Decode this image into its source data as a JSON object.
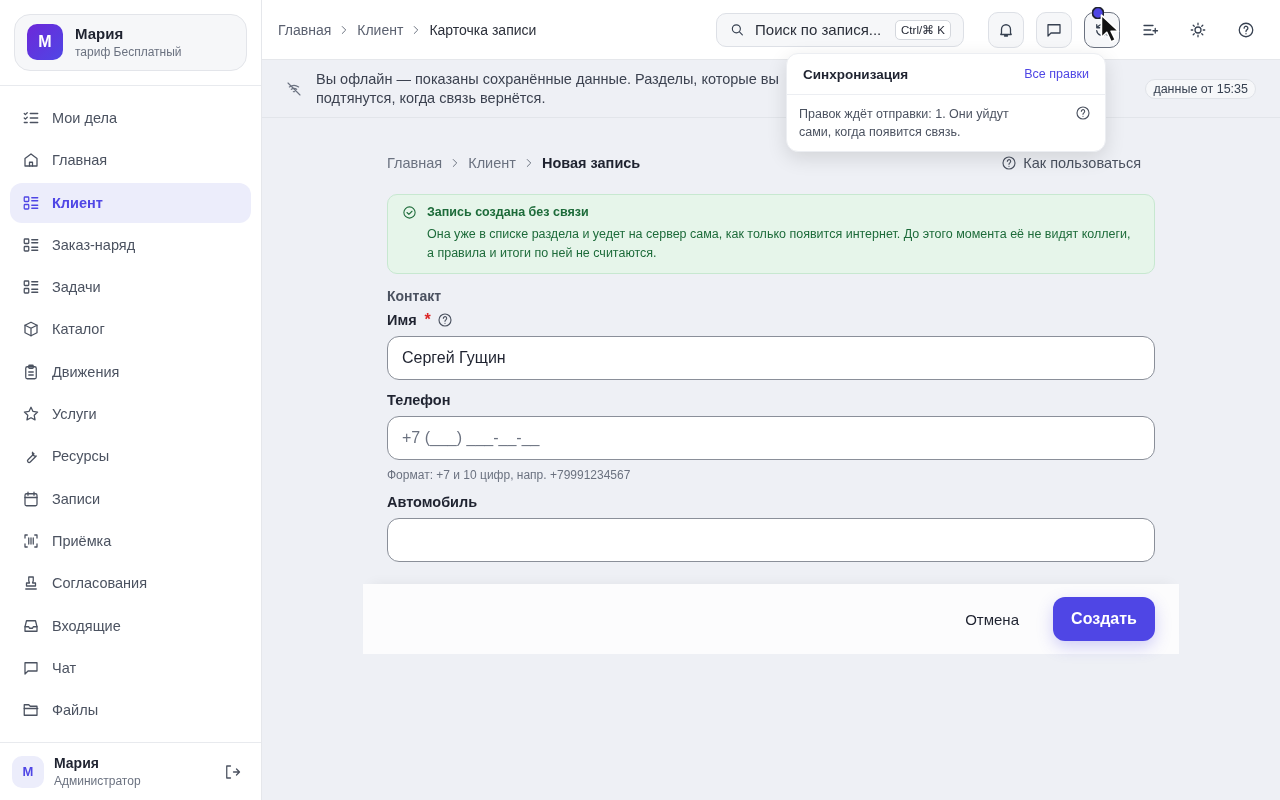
{
  "profile": {
    "initial": "М",
    "name": "Мария",
    "plan": "тариф Бесплатный"
  },
  "nav": [
    {
      "label": "Мои дела",
      "selected": false
    },
    {
      "label": "Главная",
      "selected": false
    },
    {
      "label": "Клиент",
      "selected": true
    },
    {
      "label": "Заказ-наряд",
      "selected": false
    },
    {
      "label": "Задачи",
      "selected": false
    },
    {
      "label": "Каталог",
      "selected": false
    },
    {
      "label": "Движения",
      "selected": false
    },
    {
      "label": "Услуги",
      "selected": false
    },
    {
      "label": "Ресурсы",
      "selected": false
    },
    {
      "label": "Записи",
      "selected": false
    },
    {
      "label": "Приёмка",
      "selected": false
    },
    {
      "label": "Согласования",
      "selected": false
    },
    {
      "label": "Входящие",
      "selected": false
    },
    {
      "label": "Чат",
      "selected": false
    },
    {
      "label": "Файлы",
      "selected": false
    }
  ],
  "user": {
    "initial": "М",
    "name": "Мария",
    "role": "Администратор"
  },
  "header": {
    "breadcrumbs": [
      "Главная",
      "Клиент",
      "Карточка записи"
    ],
    "search": {
      "placeholder": "Поиск по запися...",
      "shortcut": "Ctrl/⌘ K"
    }
  },
  "offline_banner": {
    "line_1": "Вы офлайн — показаны сохранённые данные. Разделы, которые вы",
    "line_2": "подтянутся, когда связь вернётся.",
    "stamp": "данные от 15:35"
  },
  "sync_popover": {
    "title": "Синхронизация",
    "link": "Все правки",
    "text": "Правок ждёт отправки: 1. Они уйдут сами, когда появится связь."
  },
  "page": {
    "breadcrumbs": [
      "Главная",
      "Клиент",
      "Новая запись"
    ],
    "help_link": "Как пользоваться"
  },
  "notice": {
    "title": "Запись создана без связи",
    "text": "Она уже в списке раздела и уедет на сервер сама, как только появится интернет. До этого момента её не видят коллеги, а правила и итоги по ней не считаются."
  },
  "form": {
    "section": "Контакт",
    "fields": [
      {
        "label": "Имя",
        "required_mark": "*",
        "help": true,
        "value": "Сергей Гущин"
      },
      {
        "label": "Телефон",
        "help": false,
        "placeholder": "+7 (___) ___-__-__",
        "hint": "Формат: +7 и 10 цифр, напр. +79991234567"
      },
      {
        "label": "Автомобиль",
        "help": false
      }
    ]
  },
  "footer": {
    "cancel": "Отмена",
    "submit": "Создать"
  }
}
